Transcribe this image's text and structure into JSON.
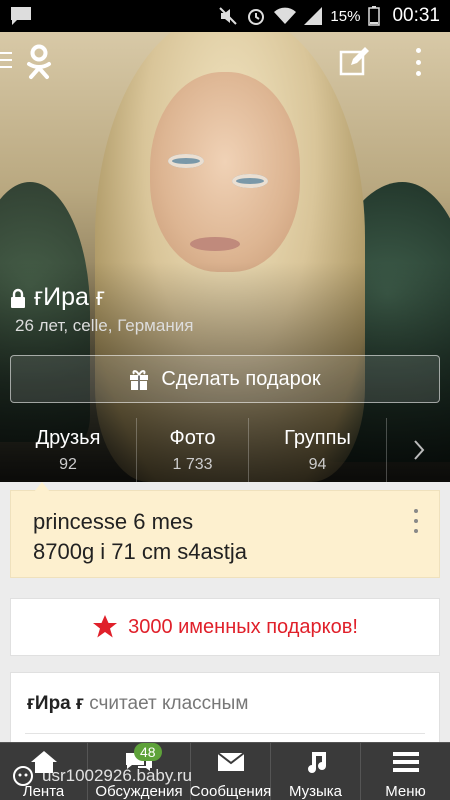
{
  "status_bar": {
    "battery": "15%",
    "time": "00:31"
  },
  "profile": {
    "name": "ғИра ғ",
    "subtitle": "26 лет, celle, Германия",
    "gift_button": "Сделать подарок"
  },
  "stats": [
    {
      "label": "Друзья",
      "count": "92"
    },
    {
      "label": "Фото",
      "count": "1 733"
    },
    {
      "label": "Группы",
      "count": "94"
    }
  ],
  "note": {
    "line1": "princesse 6 mes",
    "line2": "8700g i 71 cm s4astja"
  },
  "promo": {
    "text": "3000 именных подарков!"
  },
  "feed": {
    "actor": "ғИра ғ",
    "action": "считает классным"
  },
  "bottom_nav": [
    {
      "label": "Лента",
      "icon": "home-icon"
    },
    {
      "label": "Обсуждения",
      "icon": "discussions-icon",
      "badge": "48"
    },
    {
      "label": "Сообщения",
      "icon": "mail-icon"
    },
    {
      "label": "Музыка",
      "icon": "music-note-icon"
    },
    {
      "label": "Меню",
      "icon": "menu-icon"
    }
  ],
  "watermark": "usr1002926.baby.ru",
  "colors": {
    "accent": "#e0202a",
    "note_bg": "#fdf0cf",
    "badge": "#5ea23a",
    "nav_bg": "#3a3a3a"
  }
}
